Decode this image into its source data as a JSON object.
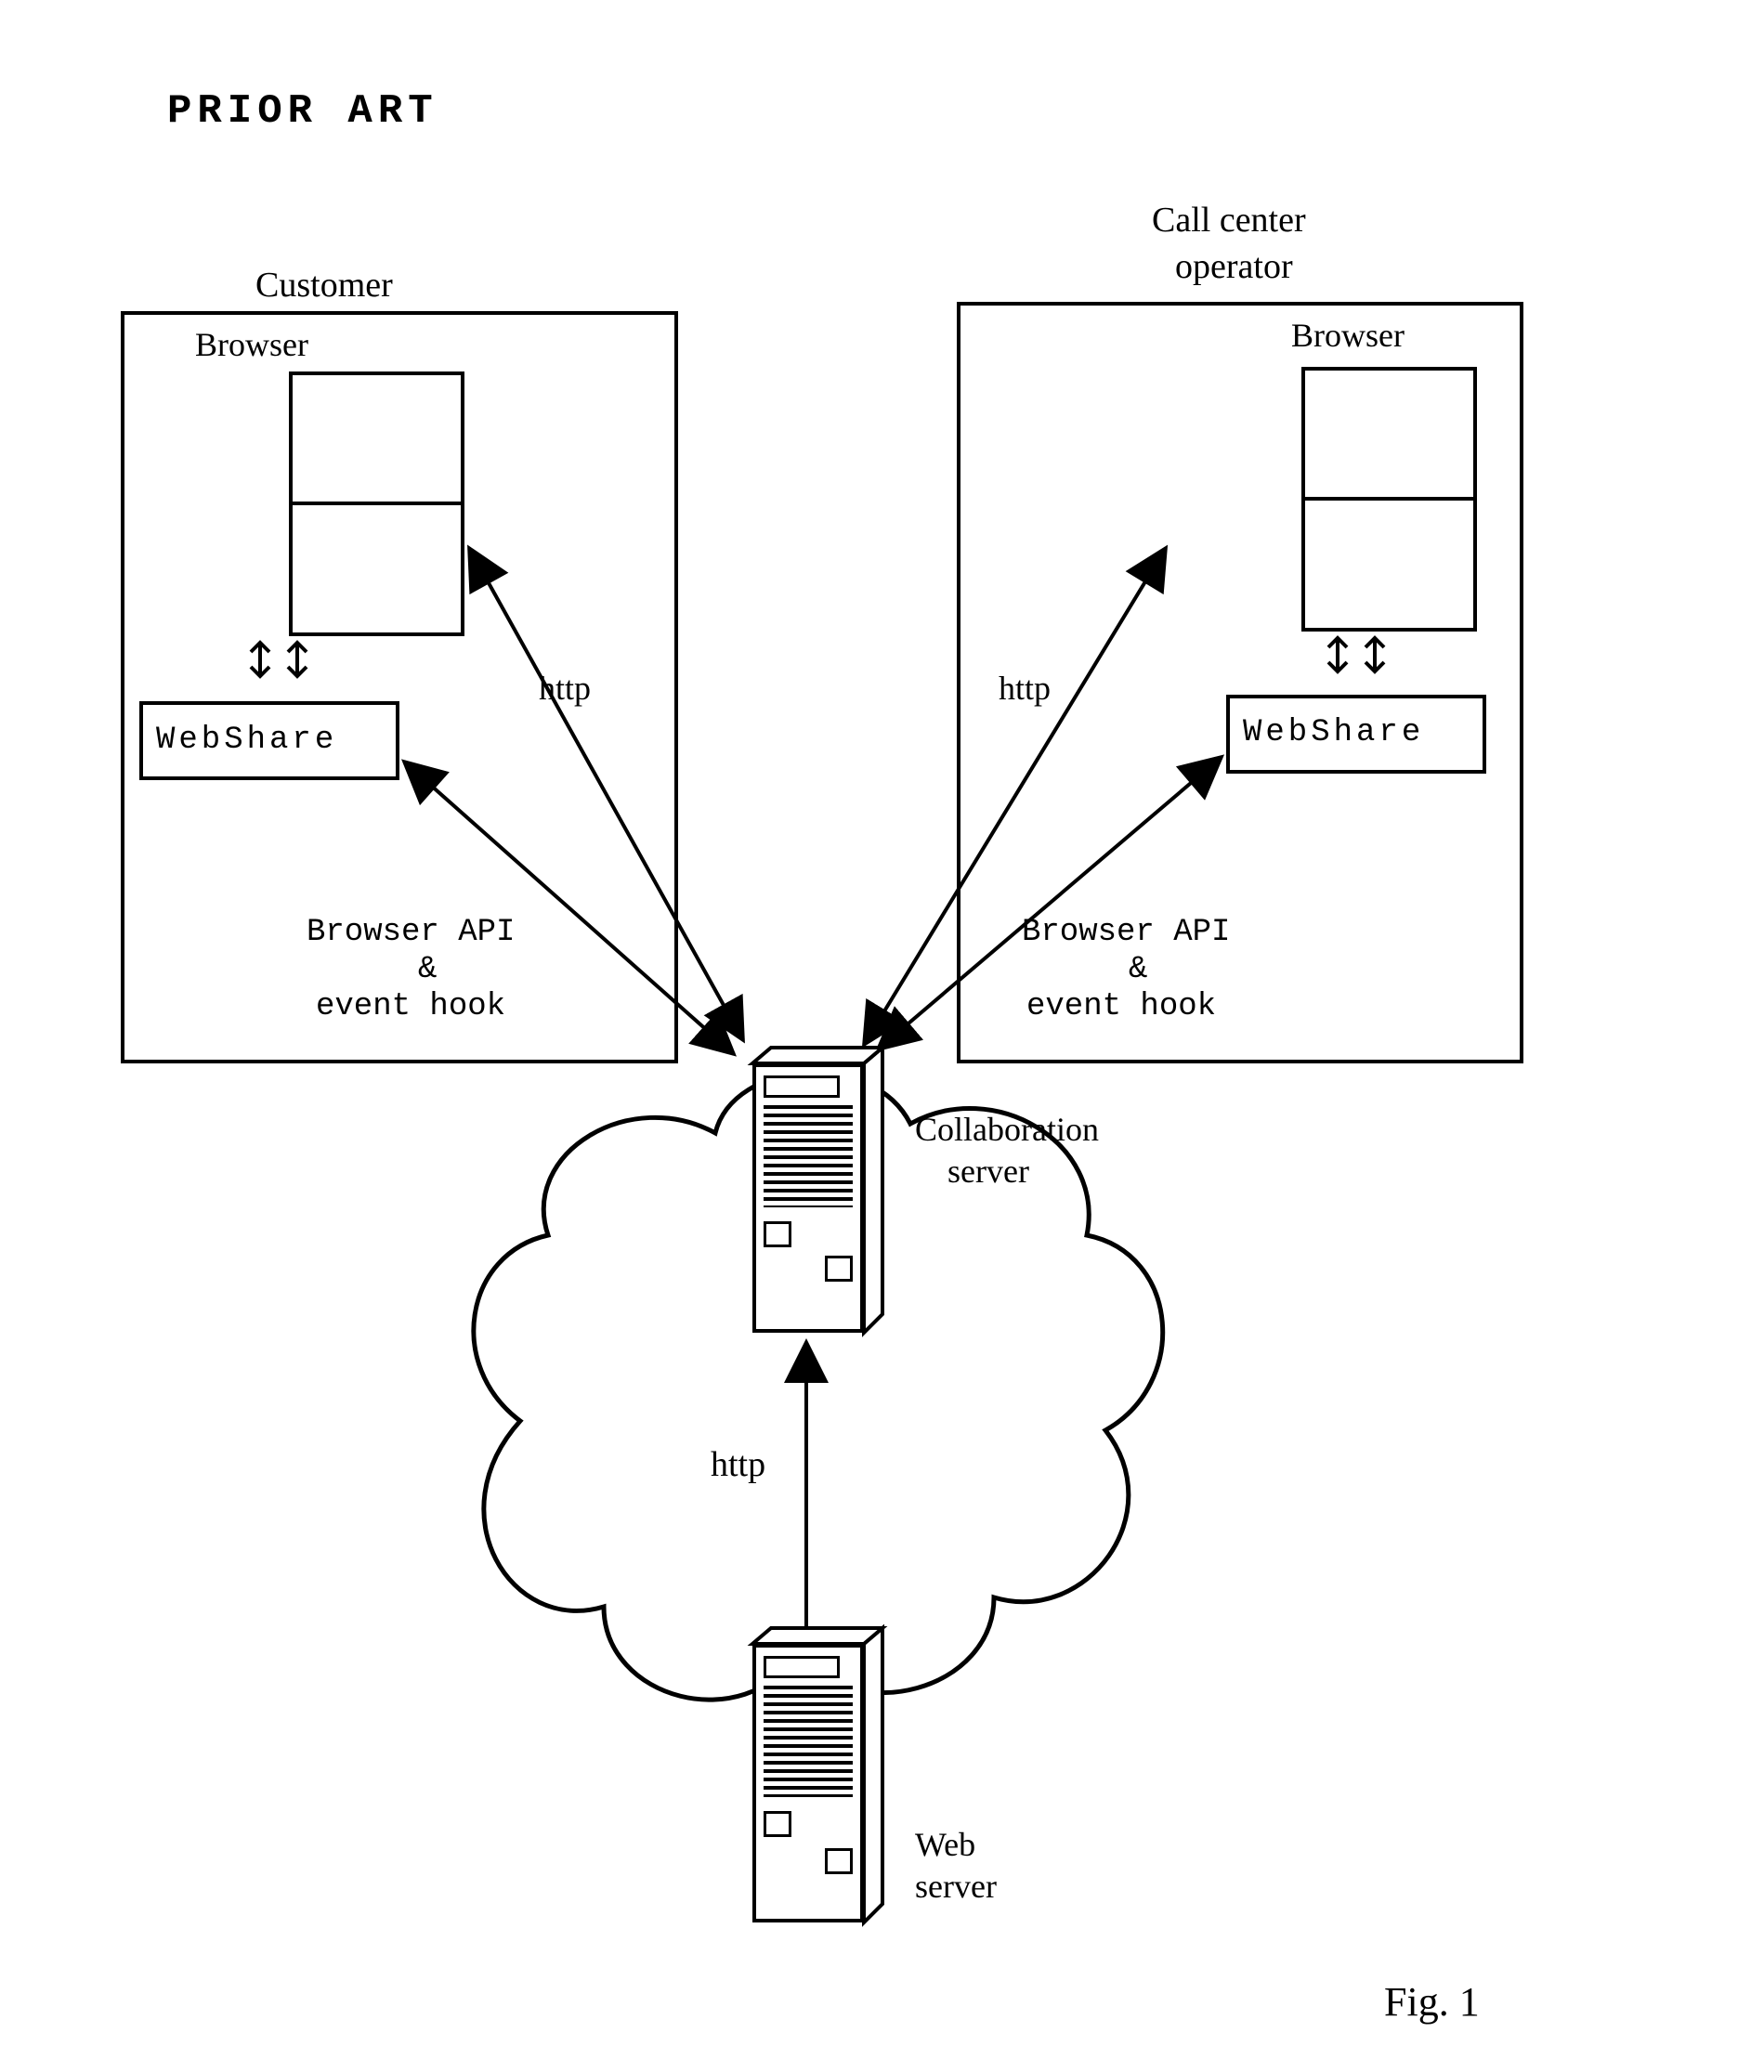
{
  "diagram": {
    "header": "PRIOR ART",
    "customer": {
      "title": "Customer",
      "browserLabel": "Browser",
      "webshare": "WebShare",
      "apiLine1": "Browser API",
      "apiLine2": "&",
      "apiLine3": "event hook",
      "httpLabel": "http"
    },
    "operator": {
      "titleLine1": "Call center",
      "titleLine2": "operator",
      "browserLabel": "Browser",
      "webshare": "WebShare",
      "apiLine1": "Browser API",
      "apiLine2": "&",
      "apiLine3": "event hook",
      "httpLabel": "http"
    },
    "collaborationServer": {
      "line1": "Collaboration",
      "line2": "server"
    },
    "cloud": {
      "httpLabel": "http"
    },
    "webServer": {
      "line1": "Web",
      "line2": "server"
    },
    "figureLabel": "Fig. 1"
  }
}
